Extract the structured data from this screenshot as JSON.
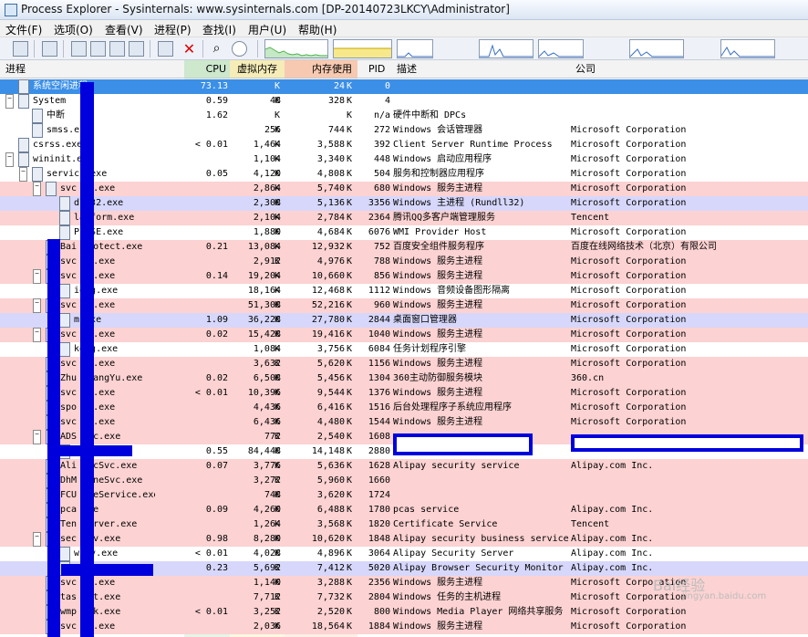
{
  "window": {
    "title": "Process Explorer - Sysinternals: www.sysinternals.com [DP-20140723LKCY\\Administrator]"
  },
  "menu": [
    "文件(F)",
    "选项(O)",
    "查看(V)",
    "进程(P)",
    "查找(I)",
    "用户(U)",
    "帮助(H)"
  ],
  "toolbar_icons": [
    "save-icon",
    "refresh-icon",
    "system-info-icon",
    "tree-icon",
    "lower-pane-icon",
    "options-icon",
    "properties-icon",
    "kill-process-icon",
    "find-icon",
    "target-icon"
  ],
  "columns": {
    "process": "进程",
    "cpu": "CPU",
    "private_bytes": "虚拟内存",
    "working_set": "内存使用",
    "pid": "PID",
    "description": "描述",
    "company": "公司"
  },
  "rows": [
    {
      "name": "系统空闲进程",
      "cpu": "73.13",
      "pvt": "",
      "pvtk": "K",
      "ws": "24",
      "wsk": "K",
      "pid": "0",
      "desc": "",
      "comp": "",
      "bg": "#3b8fe6",
      "selected": true,
      "tog": "",
      "lvl": 0
    },
    {
      "name": "System",
      "cpu": "0.59",
      "pvt": "48",
      "pvtk": "K",
      "ws": "328",
      "wsk": "K",
      "pid": "4",
      "desc": "",
      "comp": "",
      "bg": "#ffffff",
      "tog": "−",
      "lvl": 0
    },
    {
      "name": "中断",
      "cpu": "1.62",
      "pvt": "",
      "pvtk": "K",
      "ws": "",
      "wsk": "K",
      "pid": "n/a",
      "desc": "硬件中断和 DPCs",
      "comp": "",
      "bg": "#ffffff",
      "tog": "",
      "lvl": 1
    },
    {
      "name": "smss.e",
      "cpu": "",
      "pvt": "256",
      "pvtk": "K",
      "ws": "744",
      "wsk": "K",
      "pid": "272",
      "desc": "Windows 会话管理器",
      "comp": "Microsoft Corporation",
      "bg": "#ffffff",
      "tog": "",
      "lvl": 1
    },
    {
      "name": "csrss.exe",
      "cpu": "< 0.01",
      "pvt": "1,464",
      "pvtk": "K",
      "ws": "3,588",
      "wsk": "K",
      "pid": "392",
      "desc": "Client Server Runtime Process",
      "comp": "Microsoft Corporation",
      "bg": "#ffffff",
      "tog": "",
      "lvl": 0
    },
    {
      "name": "wininit.e",
      "cpu": "",
      "pvt": "1,104",
      "pvtk": "K",
      "ws": "3,340",
      "wsk": "K",
      "pid": "448",
      "desc": "Windows 启动应用程序",
      "comp": "Microsoft Corporation",
      "bg": "#ffffff",
      "tog": "−",
      "lvl": 0
    },
    {
      "name": "servic    .exe",
      "cpu": "0.05",
      "pvt": "4,120",
      "pvtk": "K",
      "ws": "4,808",
      "wsk": "K",
      "pid": "504",
      "desc": "服务和控制器应用程序",
      "comp": "Microsoft Corporation",
      "bg": "#ffffff",
      "tog": "−",
      "lvl": 1
    },
    {
      "name": "svc   st.exe",
      "cpu": "",
      "pvt": "2,864",
      "pvtk": "K",
      "ws": "5,740",
      "wsk": "K",
      "pid": "680",
      "desc": "Windows 服务主进程",
      "comp": "Microsoft Corporation",
      "bg": "#fcd2d2",
      "tog": "−",
      "lvl": 2
    },
    {
      "name": "  dl132.exe",
      "cpu": "",
      "pvt": "2,308",
      "pvtk": "K",
      "ws": "5,136",
      "wsk": "K",
      "pid": "3356",
      "desc": "Windows 主进程 (Rundll32)",
      "comp": "Microsoft Corporation",
      "bg": "#d7d7fb",
      "tog": "",
      "lvl": 3
    },
    {
      "name": "  latform.exe",
      "cpu": "",
      "pvt": "2,104",
      "pvtk": "K",
      "ws": "2,784",
      "wsk": "K",
      "pid": "2364",
      "desc": "腾讯QQ多客户端管理服务",
      "comp": "Tencent",
      "bg": "#fcd2d2",
      "tog": "",
      "lvl": 3
    },
    {
      "name": "  PrvSE.exe",
      "cpu": "",
      "pvt": "1,880",
      "pvtk": "K",
      "ws": "4,684",
      "wsk": "K",
      "pid": "6076",
      "desc": "WMI Provider Host",
      "comp": "Microsoft Corporation",
      "bg": "#ffffff",
      "tog": "",
      "lvl": 3
    },
    {
      "name": "Bai  Protect.exe",
      "cpu": "0.21",
      "pvt": "13,084",
      "pvtk": "K",
      "ws": "12,932",
      "wsk": "K",
      "pid": "752",
      "desc": "百度安全组件服务程序",
      "comp": "百度在线网络技术（北京）有限公司",
      "bg": "#fcd2d2",
      "tog": "",
      "lvl": 2
    },
    {
      "name": "svc   st.exe",
      "cpu": "",
      "pvt": "2,912",
      "pvtk": "K",
      "ws": "4,976",
      "wsk": "K",
      "pid": "788",
      "desc": "Windows 服务主进程",
      "comp": "Microsoft Corporation",
      "bg": "#fcd2d2",
      "tog": "",
      "lvl": 2
    },
    {
      "name": "svc   st.exe",
      "cpu": "0.14",
      "pvt": "19,204",
      "pvtk": "K",
      "ws": "10,660",
      "wsk": "K",
      "pid": "856",
      "desc": "Windows 服务主进程",
      "comp": "Microsoft Corporation",
      "bg": "#fcd2d2",
      "tog": "−",
      "lvl": 2
    },
    {
      "name": "  iodg.exe",
      "cpu": "",
      "pvt": "18,164",
      "pvtk": "K",
      "ws": "12,468",
      "wsk": "K",
      "pid": "1112",
      "desc": "Windows 音频设备图形隔离",
      "comp": "Microsoft Corporation",
      "bg": "#ffffff",
      "tog": "",
      "lvl": 3
    },
    {
      "name": "svc   st.exe",
      "cpu": "",
      "pvt": "51,308",
      "pvtk": "K",
      "ws": "52,216",
      "wsk": "K",
      "pid": "960",
      "desc": "Windows 服务主进程",
      "comp": "Microsoft Corporation",
      "bg": "#fcd2d2",
      "tog": "−",
      "lvl": 2
    },
    {
      "name": "  m.exe",
      "cpu": "1.09",
      "pvt": "36,228",
      "pvtk": "K",
      "ws": "27,780",
      "wsk": "K",
      "pid": "2844",
      "desc": "桌面窗口管理器",
      "comp": "Microsoft Corporation",
      "bg": "#d7d7fb",
      "tog": "",
      "lvl": 3
    },
    {
      "name": "svc   st.exe",
      "cpu": "0.02",
      "pvt": "15,428",
      "pvtk": "K",
      "ws": "19,416",
      "wsk": "K",
      "pid": "1040",
      "desc": "Windows 服务主进程",
      "comp": "Microsoft Corporation",
      "bg": "#fcd2d2",
      "tog": "−",
      "lvl": 2
    },
    {
      "name": "  keng.exe",
      "cpu": "",
      "pvt": "1,084",
      "pvtk": "K",
      "ws": "3,756",
      "wsk": "K",
      "pid": "6084",
      "desc": "任务计划程序引擎",
      "comp": "Microsoft Corporation",
      "bg": "#ffffff",
      "tog": "",
      "lvl": 3
    },
    {
      "name": "svc   st.exe",
      "cpu": "",
      "pvt": "3,632",
      "pvtk": "K",
      "ws": "5,620",
      "wsk": "K",
      "pid": "1156",
      "desc": "Windows 服务主进程",
      "comp": "Microsoft Corporation",
      "bg": "#fcd2d2",
      "tog": "",
      "lvl": 2
    },
    {
      "name": "Zhu   gFangYu.exe",
      "cpu": "0.02",
      "pvt": "6,508",
      "pvtk": "K",
      "ws": "5,456",
      "wsk": "K",
      "pid": "1304",
      "desc": "360主动防御服务模块",
      "comp": "360.cn",
      "bg": "#fcd2d2",
      "tog": "",
      "lvl": 2
    },
    {
      "name": "svc   st.exe",
      "cpu": "< 0.01",
      "pvt": "10,396",
      "pvtk": "K",
      "ws": "9,544",
      "wsk": "K",
      "pid": "1376",
      "desc": "Windows 服务主进程",
      "comp": "Microsoft Corporation",
      "bg": "#fcd2d2",
      "tog": "",
      "lvl": 2
    },
    {
      "name": "spo   sv.exe",
      "cpu": "",
      "pvt": "4,436",
      "pvtk": "K",
      "ws": "6,416",
      "wsk": "K",
      "pid": "1516",
      "desc": "后台处理程序子系统应用程序",
      "comp": "Microsoft Corporation",
      "bg": "#fcd2d2",
      "tog": "",
      "lvl": 2
    },
    {
      "name": "svc   st.exe",
      "cpu": "",
      "pvt": "6,436",
      "pvtk": "K",
      "ws": "4,480",
      "wsk": "K",
      "pid": "1544",
      "desc": "Windows 服务主进程",
      "comp": "Microsoft Corporation",
      "bg": "#fcd2d2",
      "tog": "",
      "lvl": 2
    },
    {
      "name": "ADS   Svc.exe",
      "cpu": "",
      "pvt": "772",
      "pvtk": "K",
      "ws": "2,540",
      "wsk": "K",
      "pid": "1608",
      "desc": "",
      "comp": "",
      "bg": "#fcd2d2",
      "tog": "−",
      "lvl": 2
    },
    {
      "name": "",
      "cpu": "0.55",
      "pvt": "84,448",
      "pvtk": "K",
      "ws": "14,148",
      "wsk": "K",
      "pid": "2880",
      "desc": "",
      "comp": "",
      "bg": "#ffffff",
      "tog": "",
      "lvl": 3
    },
    {
      "name": "Ali   SecSvc.exe",
      "cpu": "0.07",
      "pvt": "3,776",
      "pvtk": "K",
      "ws": "5,636",
      "wsk": "K",
      "pid": "1628",
      "desc": "Alipay security service",
      "comp": "Alipay.com Inc.",
      "bg": "#fcd2d2",
      "tog": "",
      "lvl": 2
    },
    {
      "name": "DhM   hineSvc.exe",
      "cpu": "",
      "pvt": "3,272",
      "pvtk": "K",
      "ws": "5,960",
      "wsk": "K",
      "pid": "1660",
      "desc": "",
      "comp": "",
      "bg": "#fcd2d2",
      "tog": "",
      "lvl": 2
    },
    {
      "name": "FCU   ateService.exe",
      "cpu": "",
      "pvt": "748",
      "pvtk": "K",
      "ws": "3,620",
      "wsk": "K",
      "pid": "1724",
      "desc": "",
      "comp": "",
      "bg": "#fcd2d2",
      "tog": "",
      "lvl": 2
    },
    {
      "name": "pca   exe",
      "cpu": "0.09",
      "pvt": "4,260",
      "pvtk": "K",
      "ws": "6,488",
      "wsk": "K",
      "pid": "1780",
      "desc": "pcas service",
      "comp": "Alipay.com Inc.",
      "bg": "#fcd2d2",
      "tog": "",
      "lvl": 2
    },
    {
      "name": "Ten   Server.exe",
      "cpu": "",
      "pvt": "1,264",
      "pvtk": "K",
      "ws": "3,568",
      "wsk": "K",
      "pid": "1820",
      "desc": "Certificate Service",
      "comp": "Tencent",
      "bg": "#fcd2d2",
      "tog": "",
      "lvl": 2
    },
    {
      "name": "sec   srv.exe",
      "cpu": "0.98",
      "pvt": "8,280",
      "pvtk": "K",
      "ws": "10,620",
      "wsk": "K",
      "pid": "1848",
      "desc": "Alipay security business service",
      "comp": "Alipay.com Inc.",
      "bg": "#fcd2d2",
      "tog": "−",
      "lvl": 2
    },
    {
      "name": "  wssv.exe",
      "cpu": "< 0.01",
      "pvt": "4,028",
      "pvtk": "K",
      "ws": "4,896",
      "wsk": "K",
      "pid": "3064",
      "desc": "Alipay Security Server",
      "comp": "Alipay.com Inc.",
      "bg": "#ffffff",
      "tog": "",
      "lvl": 3
    },
    {
      "name": "",
      "cpu": "0.23",
      "pvt": "5,692",
      "pvtk": "K",
      "ws": "7,412",
      "wsk": "K",
      "pid": "5020",
      "desc": "Alipay Browser Security Monitor",
      "comp": "Alipay.com Inc.",
      "bg": "#d7d7fb",
      "tog": "",
      "lvl": 3
    },
    {
      "name": "svc   st.exe",
      "cpu": "",
      "pvt": "1,140",
      "pvtk": "K",
      "ws": "3,288",
      "wsk": "K",
      "pid": "2356",
      "desc": "Windows 服务主进程",
      "comp": "Microsoft Corporation",
      "bg": "#fcd2d2",
      "tog": "",
      "lvl": 2
    },
    {
      "name": "tas   ost.exe",
      "cpu": "",
      "pvt": "7,712",
      "pvtk": "K",
      "ws": "7,732",
      "wsk": "K",
      "pid": "2804",
      "desc": "Windows 任务的主机进程",
      "comp": "Microsoft Corporation",
      "bg": "#fcd2d2",
      "tog": "",
      "lvl": 2
    },
    {
      "name": "wmp   twk.exe",
      "cpu": "< 0.01",
      "pvt": "3,252",
      "pvtk": "K",
      "ws": "2,520",
      "wsk": "K",
      "pid": "800",
      "desc": "Windows Media Player 网络共享服务",
      "comp": "Microsoft Corporation",
      "bg": "#fcd2d2",
      "tog": "",
      "lvl": 2
    },
    {
      "name": "svc   st.exe",
      "cpu": "",
      "pvt": "2,036",
      "pvtk": "K",
      "ws": "18,564",
      "wsk": "K",
      "pid": "1884",
      "desc": "Windows 服务主进程",
      "comp": "Microsoft Corporation",
      "bg": "#fcd2d2",
      "tog": "",
      "lvl": 2
    }
  ],
  "watermark": "Bai经验",
  "watermark_url": "jingyan.baidu.com",
  "colors": {
    "service": "#fcd2d2",
    "own_process": "#d7d7fb",
    "selected": "#3b8fe6",
    "cpu_column": "#e8f4e8",
    "private_bytes_column": "#fbf8e2",
    "working_set_column": "#fdeee6",
    "redaction": "#0000dd"
  }
}
